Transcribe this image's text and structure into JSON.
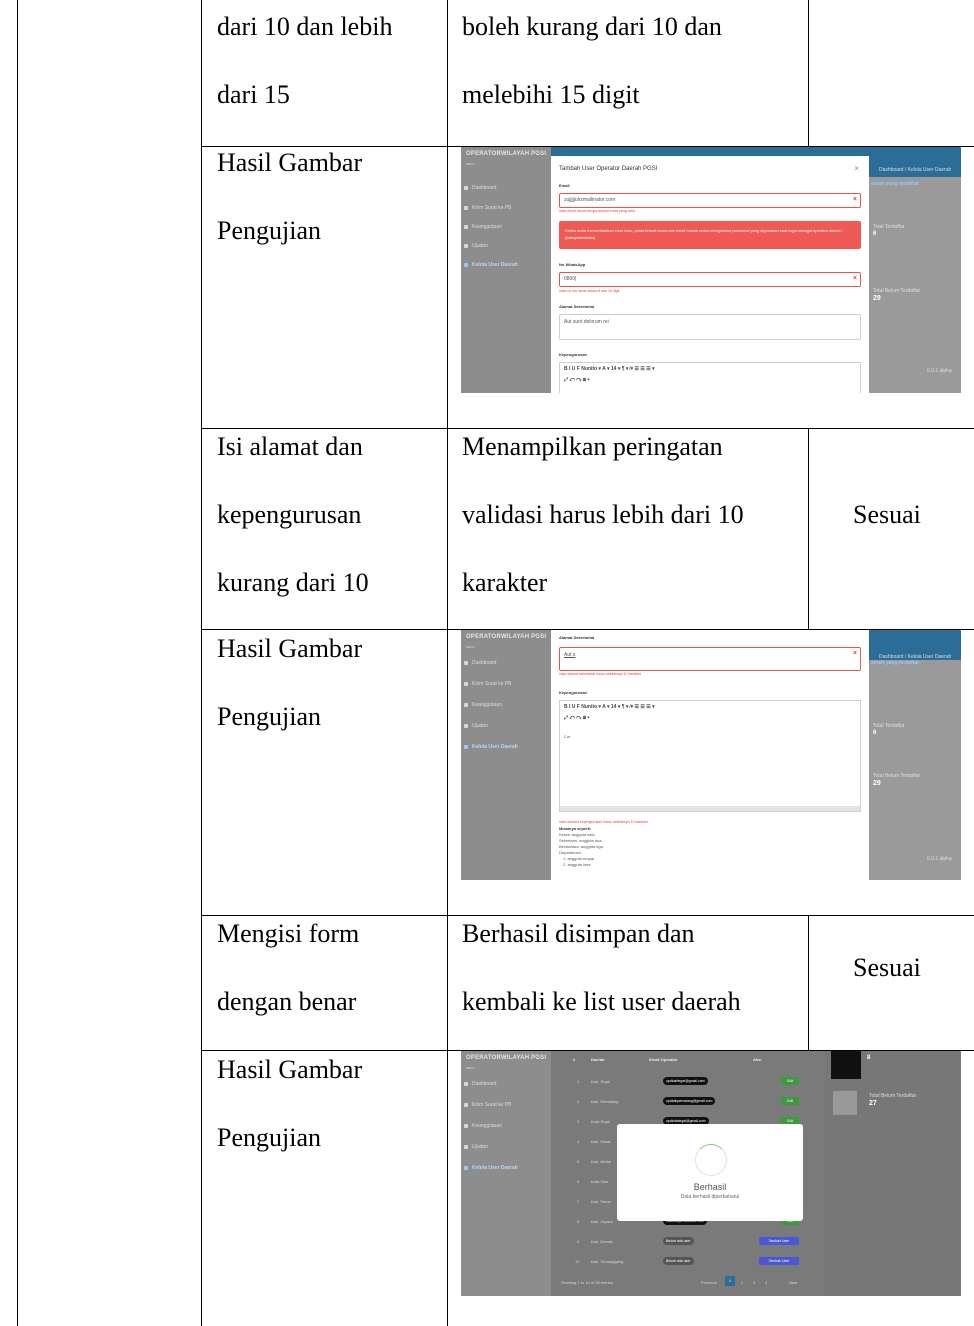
{
  "rows": [
    {
      "col1": [
        "dari 10 dan lebih",
        "dari 15"
      ],
      "col2": [
        "boleh kurang dari 10 dan",
        "melebihi 15 digit"
      ],
      "col3": ""
    },
    {
      "col1": [
        "Hasil Gambar",
        "Pengujian"
      ]
    },
    {
      "col1": [
        "Isi alamat dan",
        "kepengurusan",
        "kurang dari 10"
      ],
      "col2": [
        "Menampilkan peringatan",
        "validasi harus lebih dari 10",
        "karakter"
      ],
      "col3": "Sesuai"
    },
    {
      "col1": [
        "Hasil Gambar",
        "Pengujian"
      ]
    },
    {
      "col1": [
        "Mengisi form",
        "dengan benar"
      ],
      "col2": [
        "Berhasil disimpan dan",
        "kembali ke list user daerah"
      ],
      "col3": "Sesuai"
    },
    {
      "col1": [
        "Hasil Gambar",
        "Pengujian"
      ]
    }
  ],
  "app": {
    "brand": "OPERATORWILAYAH PGSI",
    "menu_label": "MENU",
    "menu": [
      "Dashboard",
      "Kirim Surat ke PB",
      "Keanggotaan",
      "Ujudan",
      "Kelola User Daerah"
    ],
    "breadcrumb": "Dashboard / Kelola User Daerah",
    "panel_title": "aerah yang terdaftar",
    "total_terdaftar_label": "Total Terdaftar",
    "total_terdaftar": "6",
    "total_belum_label": "Total Belum Terdaftar",
    "total_belum": "29",
    "footer": "0.0.1 alpha"
  },
  "shot1": {
    "title": "Tambah User Operator Daerah PGSI",
    "close": "×",
    "email_label": "Email",
    "email_value": "zujjjjjuhzmailinator.com",
    "email_error": "Isian email harus berupa alamat email yang valid.",
    "alert": "Ketika anda menambahkan User baru, pihak terkait harus cek email masuk untuk mengetahui password yang digunakan saat login sebagai operator daerah (kabupaten/kota)",
    "wa_label": "No WhatsApp",
    "wa_value": "0800|",
    "wa_error": "Isian no wa harus antara 8 dan 15 digit.",
    "alamat_label": "Alamat Sekretariat",
    "alamat_value": "Aut sunt dolorum rei",
    "kep_label": "Kepengurusan",
    "toolbar1": "B   I   U   F   Nunito ▾   A  ▾  14 ▾  ¶ ▾  ⁄▾  ☰  ☰  ☰ ▾",
    "toolbar2": "⤢   ↶   ↷   ⊞ ▾"
  },
  "shot2": {
    "alamat_label": "Alamat Sekretariat",
    "alamat_value": "Aut s",
    "alamat_error": "Isian alamat sekretariat harus setidaknya 10 karakter.",
    "kep_label": "Kepengurusan",
    "editor_text": "Cor",
    "kep_error": "Isian struktur kepengurusan harus setidaknya 10 karakter.",
    "example_lines": [
      "Misalnya seperti:",
      "Ketua: anggota satu",
      "Sekretaris: anggota dua",
      "Bendahara: anggota tiga",
      "Departemen",
      "1. anggota empat",
      "2. anggota lima"
    ]
  },
  "shot3": {
    "table_header": [
      "#",
      "Daerah",
      "Email Operator",
      "Aksi"
    ],
    "rows": [
      {
        "n": "1",
        "daerah": "Kab. Tegal",
        "email": "opdkabtegal@gmail.com",
        "aksi": "Edit"
      },
      {
        "n": "2",
        "daerah": "Kab. Pemalang",
        "email": "opdkabpemalang@gmail.com",
        "aksi": "Edit"
      },
      {
        "n": "3",
        "daerah": "Kota Tegal",
        "email": "opdkotategal@gmail.com",
        "aksi": "Edit"
      },
      {
        "n": "4",
        "daerah": "Kab. Pekal",
        "email": "",
        "aksi": ""
      },
      {
        "n": "5",
        "daerah": "Kab. Brebe",
        "email": "",
        "aksi": ""
      },
      {
        "n": "6",
        "daerah": "Kota Sala",
        "email": "",
        "aksi": ""
      },
      {
        "n": "7",
        "daerah": "Kab. Seme",
        "email": "",
        "aksi": ""
      },
      {
        "n": "8",
        "daerah": "Kab. Jepara",
        "email": "zakuwa@mailinator.com",
        "aksi": "Edit"
      },
      {
        "n": "9",
        "daerah": "Kab. Demak",
        "email": "Belum ada user",
        "aksi": "Tambah User"
      },
      {
        "n": "10",
        "daerah": "Kab. Temanggung",
        "email": "Belum ada user",
        "aksi": "Tambah User"
      }
    ],
    "showing": "Showing 1 to 10 of 35 entries",
    "pagination": [
      "Previous",
      "1",
      "2",
      "3",
      "4",
      "Next"
    ],
    "card_top_value": "8",
    "card_label": "Total Belum Terdaftar",
    "card_value": "27",
    "popup_title": "Berhasil",
    "popup_text": "Data berhasil diperbaharui"
  },
  "colors": {
    "error": "#e0443b",
    "alert": "#f05a55",
    "topbar": "#2b6d96",
    "success_ring": "#8dc96c"
  }
}
